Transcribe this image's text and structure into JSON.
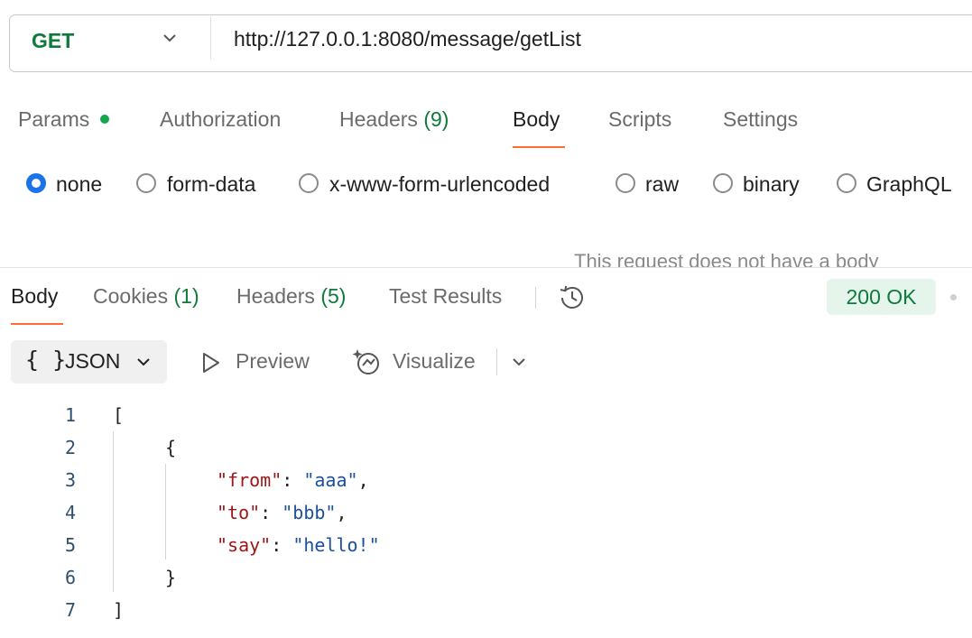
{
  "request": {
    "method": "GET",
    "url": "http://127.0.0.1:8080/message/getList",
    "tabs": {
      "params": "Params",
      "authorization": "Authorization",
      "headers": "Headers",
      "headers_count": "(9)",
      "body": "Body",
      "scripts": "Scripts",
      "settings": "Settings"
    },
    "body_types": [
      "none",
      "form-data",
      "x-www-form-urlencoded",
      "raw",
      "binary",
      "GraphQL"
    ],
    "selected_body_type": "none",
    "empty_body_message": "This request does not have a body"
  },
  "response": {
    "tabs": {
      "body": "Body",
      "cookies": "Cookies",
      "cookies_count": "(1)",
      "headers": "Headers",
      "headers_count": "(5)",
      "test_results": "Test Results"
    },
    "status": "200 OK",
    "format": {
      "braces": "{ }",
      "label": "JSON",
      "preview": "Preview",
      "visualize": "Visualize"
    },
    "code": {
      "line_numbers": [
        "1",
        "2",
        "3",
        "4",
        "5",
        "6",
        "7"
      ],
      "open_bracket": "[",
      "open_brace": "{",
      "fields": [
        {
          "key": "\"from\"",
          "value": "\"aaa\"",
          "trail": ","
        },
        {
          "key": "\"to\"",
          "value": "\"bbb\"",
          "trail": ","
        },
        {
          "key": "\"say\"",
          "value": "\"hello!\"",
          "trail": ""
        }
      ],
      "close_brace": "}",
      "close_bracket": "]"
    }
  },
  "colors": {
    "method_get": "#0e7a3c",
    "accent_tab": "#ff6c37",
    "radio_selected": "#1a73e8",
    "status_ok_bg": "#e6f5ec",
    "json_key": "#a01616",
    "json_string": "#1b4f9c"
  },
  "icons": [
    "chevron-down-icon",
    "history-icon",
    "play-icon",
    "visualize-icon"
  ]
}
